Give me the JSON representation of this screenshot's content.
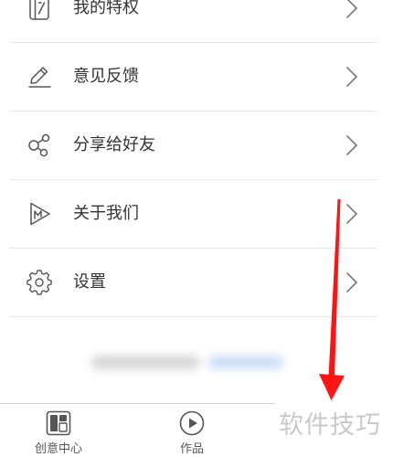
{
  "menu": {
    "items": [
      {
        "label": "我的特权",
        "icon": "privilege-card-icon"
      },
      {
        "label": "意见反馈",
        "icon": "edit-pencil-icon"
      },
      {
        "label": "分享给好友",
        "icon": "share-icon"
      },
      {
        "label": "关于我们",
        "icon": "app-logo-icon"
      },
      {
        "label": "设置",
        "icon": "gear-icon"
      }
    ],
    "chevron_icon": "chevron-right-icon"
  },
  "tab_bar": {
    "tabs": [
      {
        "label": "创意中心",
        "icon": "grid-layout-icon"
      },
      {
        "label": "作品",
        "icon": "play-circle-icon"
      }
    ]
  },
  "watermark": "软件技巧",
  "annotation": {
    "icon": "red-arrow-down-icon",
    "color": "#ff1414"
  },
  "colors": {
    "text": "#333333",
    "icon": "#555555",
    "divider": "#e6e6e6",
    "chevron": "#777777",
    "tab_label": "#555555",
    "watermark": "#c9c9c9",
    "arrow": "#ff1414"
  }
}
